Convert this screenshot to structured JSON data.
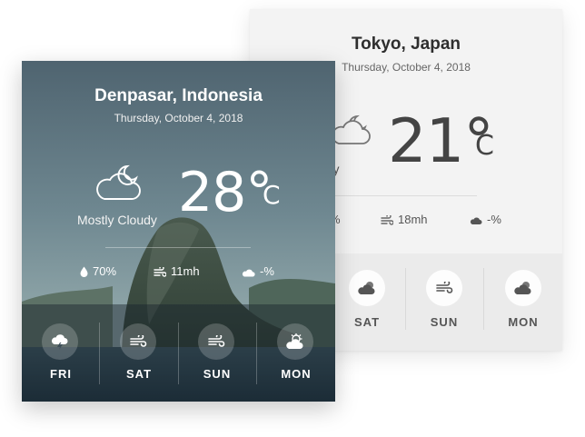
{
  "back_card": {
    "city": "Tokyo, Japan",
    "date": "Thursday, October 4, 2018",
    "condition": "loudy",
    "temperature": "21°",
    "unit": "C",
    "humidity": "%",
    "wind": "18mh",
    "precipitation": "-%",
    "forecast": [
      {
        "day": "SAT",
        "icon": "cloudy-night-icon"
      },
      {
        "day": "SUN",
        "icon": "wind-icon"
      },
      {
        "day": "MON",
        "icon": "cloudy-night-icon"
      }
    ]
  },
  "front_card": {
    "city": "Denpasar, Indonesia",
    "date": "Thursday, October 4, 2018",
    "condition": "Mostly Cloudy",
    "temperature": "28°",
    "unit": "C",
    "humidity": "70%",
    "wind": "11mh",
    "precipitation": "-%",
    "forecast": [
      {
        "day": "FRI",
        "icon": "thunderstorm-icon"
      },
      {
        "day": "SAT",
        "icon": "wind-icon"
      },
      {
        "day": "SUN",
        "icon": "wind-icon"
      },
      {
        "day": "MON",
        "icon": "partly-cloudy-icon"
      }
    ]
  },
  "colors": {
    "back_card_bg": "#f3f3f3",
    "back_text": "#444444",
    "front_text": "#ffffff"
  }
}
